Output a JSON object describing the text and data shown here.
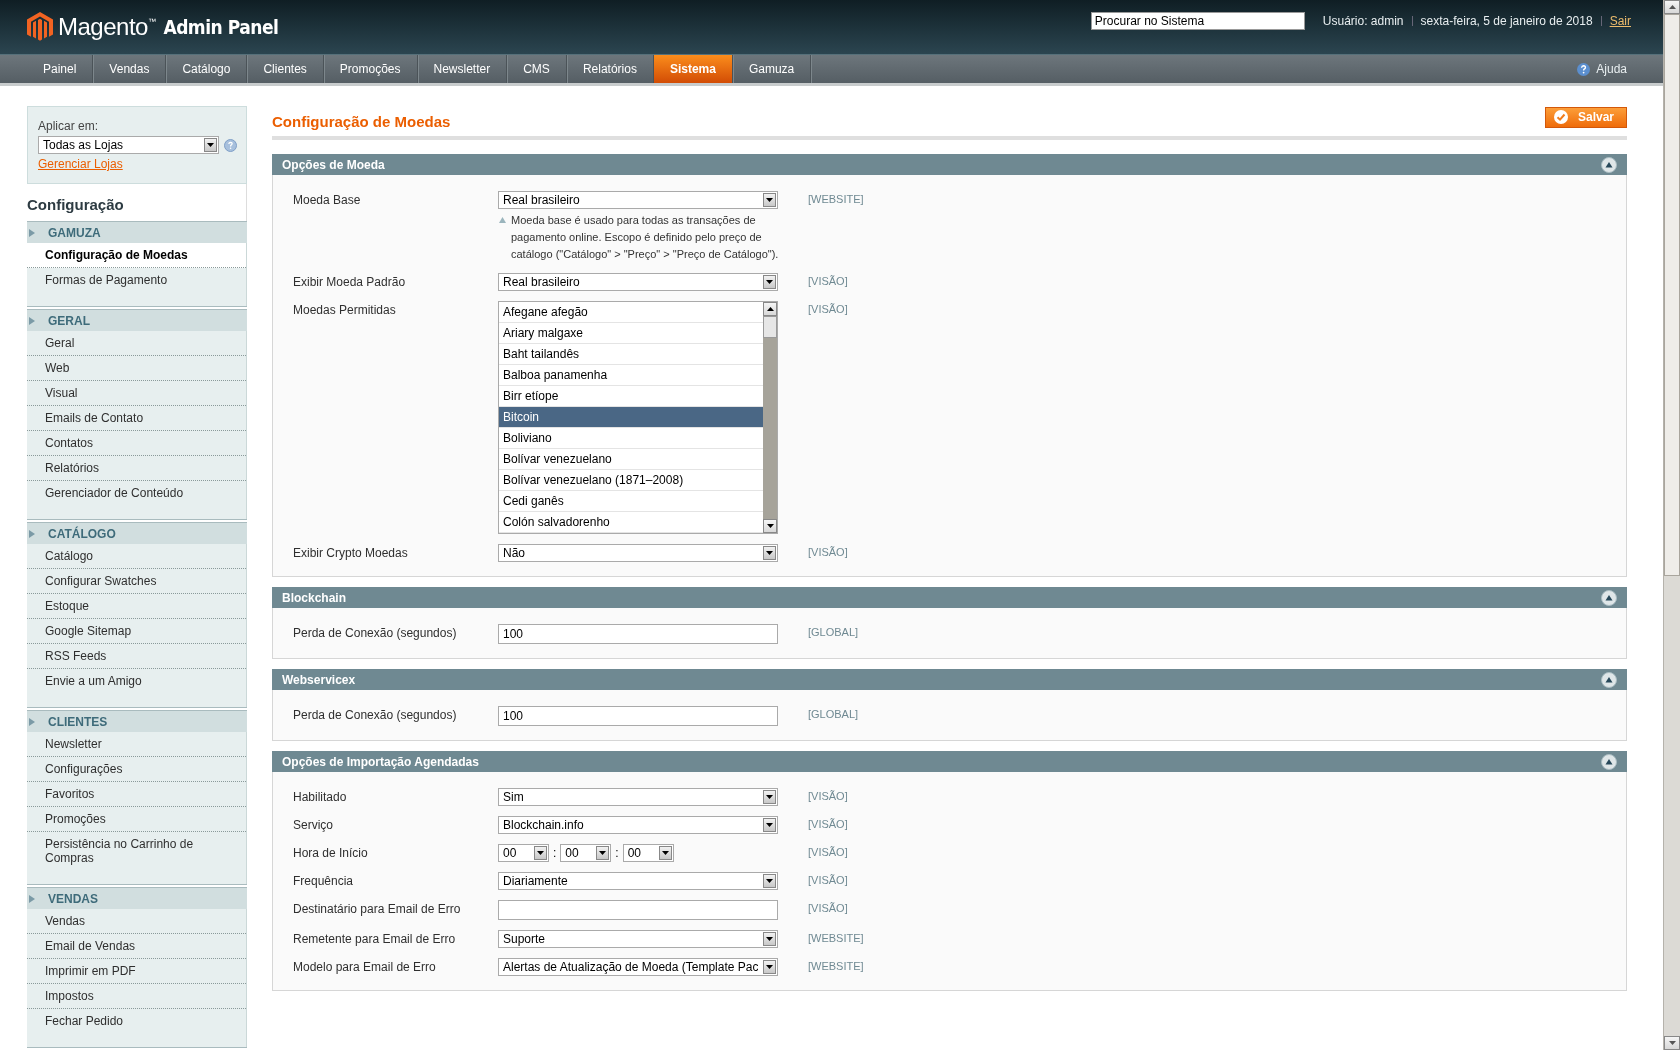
{
  "header": {
    "brand": "Magento",
    "brand_tm": "™",
    "brand_suffix": "Admin Panel",
    "search": {
      "value": "Procurar no Sistema"
    },
    "user": "Usuário: admin",
    "date": "sexta-feira, 5 de janeiro de 2018",
    "logout": "Sair"
  },
  "nav": {
    "tabs": [
      {
        "label": "Painel",
        "selected": false
      },
      {
        "label": "Vendas",
        "selected": false
      },
      {
        "label": "Catálogo",
        "selected": false
      },
      {
        "label": "Clientes",
        "selected": false
      },
      {
        "label": "Promoções",
        "selected": false
      },
      {
        "label": "Newsletter",
        "selected": false
      },
      {
        "label": "CMS",
        "selected": false
      },
      {
        "label": "Relatórios",
        "selected": false
      },
      {
        "label": "Sistema",
        "selected": true
      },
      {
        "label": "Gamuza",
        "selected": false
      }
    ],
    "help": "Ajuda"
  },
  "sidebar": {
    "scope_label": "Aplicar em:",
    "scope_value": "Todas as Lojas",
    "manage_link": "Gerenciar Lojas",
    "title": "Configuração",
    "sections": [
      {
        "title": "GAMUZA",
        "items": [
          {
            "label": "Configuração de Moedas",
            "selected": true
          },
          {
            "label": "Formas de Pagamento",
            "selected": false
          }
        ]
      },
      {
        "title": "GERAL",
        "items": [
          {
            "label": "Geral",
            "selected": false
          },
          {
            "label": "Web",
            "selected": false
          },
          {
            "label": "Visual",
            "selected": false
          },
          {
            "label": "Emails de Contato",
            "selected": false
          },
          {
            "label": "Contatos",
            "selected": false
          },
          {
            "label": "Relatórios",
            "selected": false
          },
          {
            "label": "Gerenciador de Conteúdo",
            "selected": false
          }
        ]
      },
      {
        "title": "CATÁLOGO",
        "items": [
          {
            "label": "Catálogo",
            "selected": false
          },
          {
            "label": "Configurar Swatches",
            "selected": false
          },
          {
            "label": "Estoque",
            "selected": false
          },
          {
            "label": "Google Sitemap",
            "selected": false
          },
          {
            "label": "RSS Feeds",
            "selected": false
          },
          {
            "label": "Envie a um Amigo",
            "selected": false
          }
        ]
      },
      {
        "title": "CLIENTES",
        "items": [
          {
            "label": "Newsletter",
            "selected": false
          },
          {
            "label": "Configurações",
            "selected": false
          },
          {
            "label": "Favoritos",
            "selected": false
          },
          {
            "label": "Promoções",
            "selected": false
          },
          {
            "label": "Persistência no Carrinho de Compras",
            "selected": false
          }
        ]
      },
      {
        "title": "VENDAS",
        "items": [
          {
            "label": "Vendas",
            "selected": false
          },
          {
            "label": "Email de Vendas",
            "selected": false
          },
          {
            "label": "Imprimir em PDF",
            "selected": false
          },
          {
            "label": "Impostos",
            "selected": false
          },
          {
            "label": "Fechar Pedido",
            "selected": false
          }
        ]
      }
    ]
  },
  "main": {
    "title": "Configuração de Moedas",
    "save_button": "Salvar",
    "sections": [
      {
        "title": "Opções de Moeda",
        "fields": [
          {
            "kind": "select",
            "label": "Moeda Base",
            "value": "Real brasileiro",
            "scope": "[WEBSITE]",
            "note": "Moeda base é usado para todas as transações de pagamento online. Escopo é definido pelo preço de catálogo (\"Catálogo\" > \"Preço\" > \"Preço de Catálogo\")."
          },
          {
            "kind": "select",
            "label": "Exibir Moeda Padrão",
            "value": "Real brasileiro",
            "scope": "[VISÃO]"
          },
          {
            "kind": "multiselect",
            "label": "Moedas Permitidas",
            "scope": "[VISÃO]",
            "options": [
              {
                "label": "Afegane afegão",
                "selected": false
              },
              {
                "label": "Ariary malgaxe",
                "selected": false
              },
              {
                "label": "Baht tailandês",
                "selected": false
              },
              {
                "label": "Balboa panamenha",
                "selected": false
              },
              {
                "label": "Birr etíope",
                "selected": false
              },
              {
                "label": "Bitcoin",
                "selected": true
              },
              {
                "label": "Boliviano",
                "selected": false
              },
              {
                "label": "Bolívar venezuelano",
                "selected": false
              },
              {
                "label": "Bolívar venezuelano (1871–2008)",
                "selected": false
              },
              {
                "label": "Cedi ganês",
                "selected": false
              },
              {
                "label": "Colón salvadorenho",
                "selected": false
              }
            ]
          },
          {
            "kind": "select",
            "label": "Exibir Crypto Moedas",
            "value": "Não",
            "scope": "[VISÃO]"
          }
        ]
      },
      {
        "title": "Blockchain",
        "fields": [
          {
            "kind": "input",
            "label": "Perda de Conexão (segundos)",
            "value": "100",
            "scope": "[GLOBAL]"
          }
        ]
      },
      {
        "title": "Webservicex",
        "fields": [
          {
            "kind": "input",
            "label": "Perda de Conexão (segundos)",
            "value": "100",
            "scope": "[GLOBAL]"
          }
        ]
      },
      {
        "title": "Opções de Importação Agendadas",
        "fields": [
          {
            "kind": "select",
            "label": "Habilitado",
            "value": "Sim",
            "scope": "[VISÃO]"
          },
          {
            "kind": "select",
            "label": "Serviço",
            "value": "Blockchain.info",
            "scope": "[VISÃO]"
          },
          {
            "kind": "time",
            "label": "Hora de Início",
            "parts": [
              "00",
              "00",
              "00"
            ],
            "separators": [
              ":",
              ":"
            ],
            "scope": "[VISÃO]"
          },
          {
            "kind": "select",
            "label": "Frequência",
            "value": "Diariamente",
            "scope": "[VISÃO]"
          },
          {
            "kind": "input",
            "label": "Destinatário para Email de Erro",
            "scope": "[VISÃO]"
          },
          {
            "kind": "select",
            "label": "Remetente para Email de Erro",
            "value": "Suporte",
            "scope": "[WEBSITE]"
          },
          {
            "kind": "select",
            "label": "Modelo para Email de Erro",
            "value": "Alertas de Atualização de Moeda (Template Pac",
            "scope": "[WEBSITE]"
          }
        ]
      }
    ]
  }
}
